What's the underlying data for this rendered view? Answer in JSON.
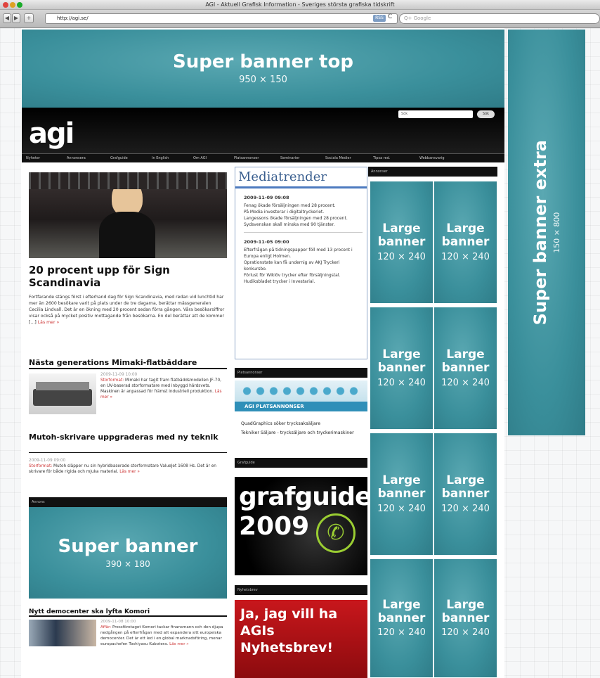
{
  "window": {
    "title": "AGI - Aktuell Grafisk Information - Sveriges största grafiska tidskrift",
    "url": "http://agi.se/",
    "rss_label": "RSS",
    "reload_label": "C",
    "search_placeholder": "Q+ Google"
  },
  "ads": {
    "super_top": {
      "title": "Super banner top",
      "size": "950 × 150"
    },
    "super_extra": {
      "title": "Super banner extra",
      "size": "150 × 800"
    },
    "super_banner": {
      "title": "Super banner",
      "size": "390 × 180"
    },
    "large": {
      "line1": "Large",
      "line2": "banner",
      "size": "120 × 240"
    }
  },
  "site": {
    "logo": "agi",
    "search_value": "Sök",
    "search_button": "Sök",
    "nav": [
      "Nyheter",
      "Annonsera",
      "Grafguide",
      "In English",
      "Om AGI",
      "Platsannonser",
      "Seminarier",
      "Sociala Medier",
      "Tipsa red.",
      "Webbansvarig"
    ]
  },
  "articles": {
    "main_title": "20 procent upp för Sign Scandinavia",
    "main_body": "Fortfarande stängs först i efterhand dag för Sign Scandinavia, med redan vid lunchtid har mer än 2600 besökare varit på plats under de tre dagarna, berättar mässgeneralen Cecilia Lindvall. Det är en ökning med 20 procent sedan förra gången. Våra besökarsiffror visar också på mycket positiv mottagande från besökarna. En del berättar att de kommer [...]",
    "main_readmore": "Läs mer »",
    "a2_title": "Nästa generations Mimaki-flatbäddare",
    "a2_date": "2009-11-09 10:00",
    "a2_tag": "Storformat:",
    "a2_body": "Mimaki har tagit fram flatbäddsmodellen JF-70, en UV-baserad storformatare med inbyggd härdsvets. Maskinen är anpassad för främst industriell produktion.",
    "a2_readmore": "Läs mer »",
    "a3_title": "Mutoh-skrivare uppgraderas med ny teknik",
    "a3_date": "2009-11-09 09:00",
    "a3_tag": "Storformat:",
    "a3_body": "Mutoh släpper nu sin hybridbaserade storformatare ValueJet 1608 Hs. Det är en skrivare för både rigida och mjuka material.",
    "a3_readmore": "Läs mer »",
    "annons_label": "Annons",
    "a4_title": "Nytt democenter ska lyfta Komori",
    "a4_date": "2009-11-08 10:00",
    "a4_tag": "Affär:",
    "a4_body": "Pressföretaget Komori tackar finansmann och den djupa nedgången på efterfrågan med att expandera sitt europeiska democenter. Det är ett led i en global marknadsföring, menar europachefen Toshiyasu Kubotera.",
    "a4_readmore": "Läs mer »"
  },
  "mediatrender": {
    "title": "Mediatrender",
    "entries": [
      {
        "date": "2009-11-09 09:08",
        "lines": [
          "Fenag ökade försäljningen med 28 procent.",
          "På Modia investerar i digitaltryckeriet.",
          "Langessons ökade försäljningen med 28 procent.",
          "Sydsvenskan skall minska med 90 tjänster."
        ]
      },
      {
        "date": "2009-11-05 09:00",
        "lines": [
          "Efterfrågan på tidningspapper föll med 13 procent i Europa enligt Holmen.",
          "Oprationstate kan få undernig av AKJ Tryckeri konkursbo.",
          "Förlust för Wiklöv trycker efter försäljningstal.",
          "Hudiksbladet trycker i Investarial."
        ]
      }
    ]
  },
  "sidebar": {
    "annonser_label": "Annonser",
    "plats_label": "Platsannonser",
    "plats_banner_text": "AGI PLATSANNONSER",
    "plats_links": [
      "QuadGraphics söker trycksaksäljare",
      "Tekniker Säljare - trycksäljare och tryckerimaskiner"
    ],
    "grafguide_label": "Grafguide",
    "grafguide_word": "grafguide",
    "grafguide_year": "2009",
    "nyhetsbrev_label": "Nyhetsbrev",
    "nyhetsbrev_text": "Ja, jag vill ha AGIs Nyhetsbrev!"
  }
}
